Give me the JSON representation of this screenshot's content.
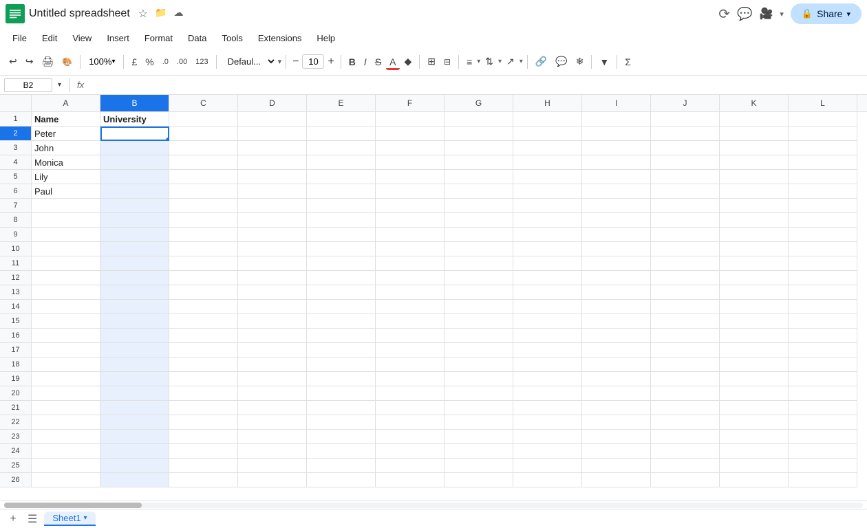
{
  "app": {
    "title": "Untitled spreadsheet",
    "logo_color": "#0f9d58",
    "logo_bg": "#ffffff"
  },
  "title_icons": {
    "star": "☆",
    "folder": "📁",
    "cloud": "☁"
  },
  "top_right": {
    "history_icon": "⟳",
    "comment_icon": "💬",
    "video_icon": "📹",
    "share_label": "Share",
    "expand_icon": "▾"
  },
  "menu": {
    "items": [
      "File",
      "Edit",
      "View",
      "Insert",
      "Format",
      "Data",
      "Tools",
      "Extensions",
      "Help"
    ]
  },
  "toolbar": {
    "undo_icon": "↩",
    "redo_icon": "↪",
    "print_icon": "🖨",
    "paint_icon": "🎨",
    "zoom_value": "100%",
    "currency_icon": "£",
    "percent_icon": "%",
    "decrease_decimal": ".0",
    "increase_decimal": ".00",
    "number_format": "123",
    "font_family": "Defaul...",
    "font_size": "10",
    "bold": "B",
    "italic": "I",
    "strikethrough": "S",
    "text_color_icon": "A",
    "fill_color_icon": "◆",
    "borders_icon": "⊞",
    "merge_icon": "⊟",
    "halign_icon": "≡",
    "valign_icon": "⇅",
    "text_rotate_icon": "↗",
    "link_icon": "🔗",
    "comment_icon": "💬",
    "freeze_icon": "❄",
    "filter_icon": "▼",
    "filter2_icon": "⋮",
    "more_icon": "Σ"
  },
  "formula_bar": {
    "cell_ref": "B2",
    "fx_label": "fx"
  },
  "columns": [
    "A",
    "B",
    "C",
    "D",
    "E",
    "F",
    "G",
    "H",
    "I",
    "J",
    "K",
    "L"
  ],
  "rows": [
    {
      "num": 1,
      "cells": [
        {
          "val": "Name",
          "header": true
        },
        {
          "val": "University",
          "header": true
        },
        "",
        "",
        "",
        "",
        "",
        "",
        "",
        "",
        "",
        ""
      ]
    },
    {
      "num": 2,
      "cells": [
        {
          "val": "Peter"
        },
        {
          "val": "",
          "active": true
        },
        "",
        "",
        "",
        "",
        "",
        "",
        "",
        "",
        "",
        ""
      ]
    },
    {
      "num": 3,
      "cells": [
        {
          "val": "John"
        },
        "",
        "",
        "",
        "",
        "",
        "",
        "",
        "",
        "",
        "",
        ""
      ]
    },
    {
      "num": 4,
      "cells": [
        {
          "val": "Monica"
        },
        "",
        "",
        "",
        "",
        "",
        "",
        "",
        "",
        "",
        "",
        ""
      ]
    },
    {
      "num": 5,
      "cells": [
        {
          "val": "Lily"
        },
        "",
        "",
        "",
        "",
        "",
        "",
        "",
        "",
        "",
        "",
        ""
      ]
    },
    {
      "num": 6,
      "cells": [
        {
          "val": "Paul"
        },
        "",
        "",
        "",
        "",
        "",
        "",
        "",
        "",
        "",
        "",
        ""
      ]
    },
    {
      "num": 7,
      "cells": [
        "",
        "",
        "",
        "",
        "",
        "",
        "",
        "",
        "",
        "",
        "",
        ""
      ]
    },
    {
      "num": 8,
      "cells": [
        "",
        "",
        "",
        "",
        "",
        "",
        "",
        "",
        "",
        "",
        "",
        ""
      ]
    },
    {
      "num": 9,
      "cells": [
        "",
        "",
        "",
        "",
        "",
        "",
        "",
        "",
        "",
        "",
        "",
        ""
      ]
    },
    {
      "num": 10,
      "cells": [
        "",
        "",
        "",
        "",
        "",
        "",
        "",
        "",
        "",
        "",
        "",
        ""
      ]
    },
    {
      "num": 11,
      "cells": [
        "",
        "",
        "",
        "",
        "",
        "",
        "",
        "",
        "",
        "",
        "",
        ""
      ]
    },
    {
      "num": 12,
      "cells": [
        "",
        "",
        "",
        "",
        "",
        "",
        "",
        "",
        "",
        "",
        "",
        ""
      ]
    },
    {
      "num": 13,
      "cells": [
        "",
        "",
        "",
        "",
        "",
        "",
        "",
        "",
        "",
        "",
        "",
        ""
      ]
    },
    {
      "num": 14,
      "cells": [
        "",
        "",
        "",
        "",
        "",
        "",
        "",
        "",
        "",
        "",
        "",
        ""
      ]
    },
    {
      "num": 15,
      "cells": [
        "",
        "",
        "",
        "",
        "",
        "",
        "",
        "",
        "",
        "",
        "",
        ""
      ]
    },
    {
      "num": 16,
      "cells": [
        "",
        "",
        "",
        "",
        "",
        "",
        "",
        "",
        "",
        "",
        "",
        ""
      ]
    },
    {
      "num": 17,
      "cells": [
        "",
        "",
        "",
        "",
        "",
        "",
        "",
        "",
        "",
        "",
        "",
        ""
      ]
    },
    {
      "num": 18,
      "cells": [
        "",
        "",
        "",
        "",
        "",
        "",
        "",
        "",
        "",
        "",
        "",
        ""
      ]
    },
    {
      "num": 19,
      "cells": [
        "",
        "",
        "",
        "",
        "",
        "",
        "",
        "",
        "",
        "",
        "",
        ""
      ]
    },
    {
      "num": 20,
      "cells": [
        "",
        "",
        "",
        "",
        "",
        "",
        "",
        "",
        "",
        "",
        "",
        ""
      ]
    },
    {
      "num": 21,
      "cells": [
        "",
        "",
        "",
        "",
        "",
        "",
        "",
        "",
        "",
        "",
        "",
        ""
      ]
    },
    {
      "num": 22,
      "cells": [
        "",
        "",
        "",
        "",
        "",
        "",
        "",
        "",
        "",
        "",
        "",
        ""
      ]
    },
    {
      "num": 23,
      "cells": [
        "",
        "",
        "",
        "",
        "",
        "",
        "",
        "",
        "",
        "",
        "",
        ""
      ]
    },
    {
      "num": 24,
      "cells": [
        "",
        "",
        "",
        "",
        "",
        "",
        "",
        "",
        "",
        "",
        "",
        ""
      ]
    },
    {
      "num": 25,
      "cells": [
        "",
        "",
        "",
        "",
        "",
        "",
        "",
        "",
        "",
        "",
        "",
        ""
      ]
    },
    {
      "num": 26,
      "cells": [
        "",
        "",
        "",
        "",
        "",
        "",
        "",
        "",
        "",
        "",
        "",
        ""
      ]
    }
  ],
  "sheets": [
    {
      "label": "Sheet1",
      "active": true
    }
  ],
  "add_sheet_icon": "+",
  "sheet_list_icon": "☰"
}
